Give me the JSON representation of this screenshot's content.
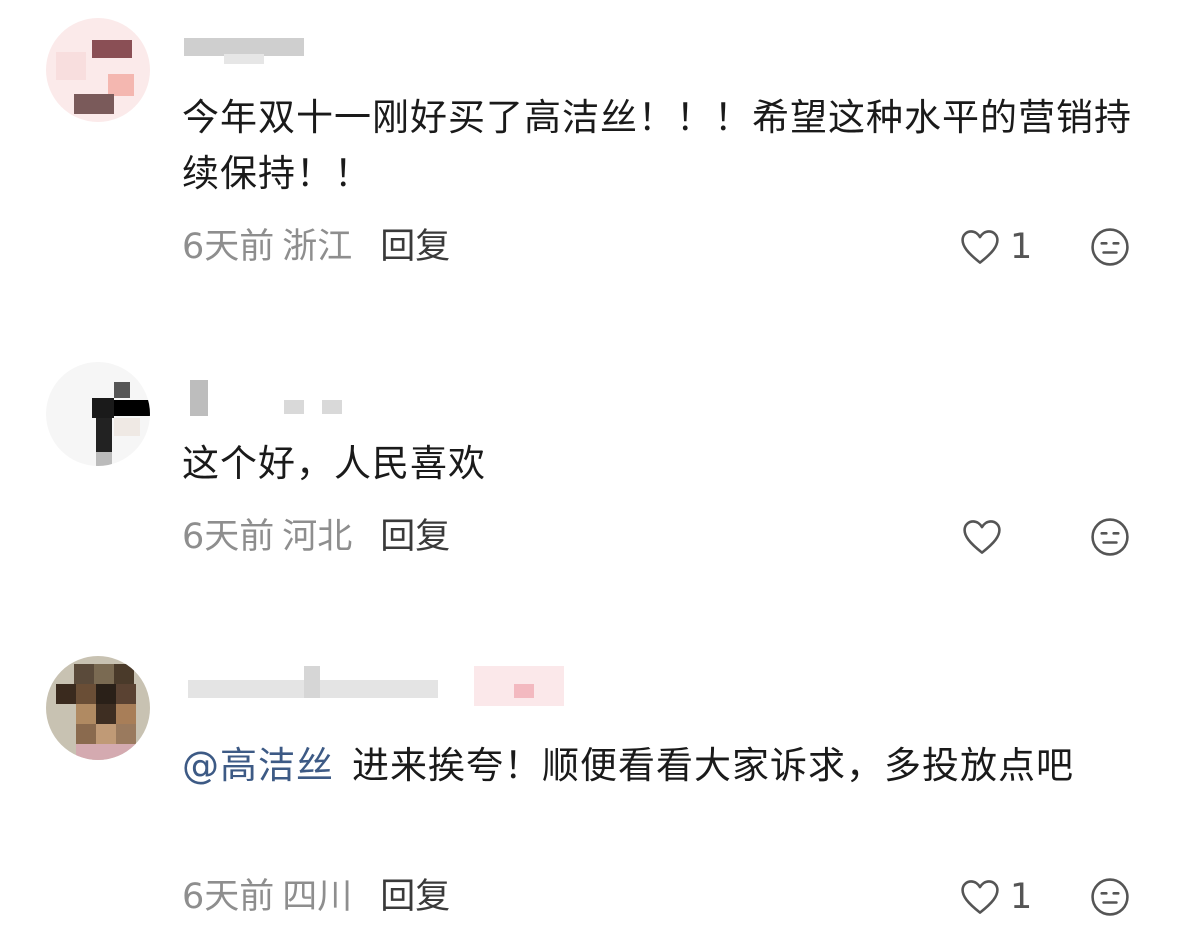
{
  "comments": [
    {
      "text": "今年双十一刚好买了高洁丝！！！希望这种水平的营销持续保持！！",
      "mention": "",
      "time": "6天前",
      "location": "浙江",
      "reply": "回复",
      "likes": "1"
    },
    {
      "text": "这个好，人民喜欢",
      "mention": "",
      "time": "6天前",
      "location": "河北",
      "reply": "回复",
      "likes": ""
    },
    {
      "text": "进来挨夸！顺便看看大家诉求，多投放点吧",
      "mention": "@高洁丝",
      "time": "6天前",
      "location": "四川",
      "reply": "回复",
      "likes": "1"
    }
  ],
  "icons": {
    "like": "heart-icon",
    "dislike": "neutral-face-icon"
  },
  "colors": {
    "mention": "#3d5a85",
    "meta": "#8e8e8e",
    "text": "#1a1a1a"
  }
}
